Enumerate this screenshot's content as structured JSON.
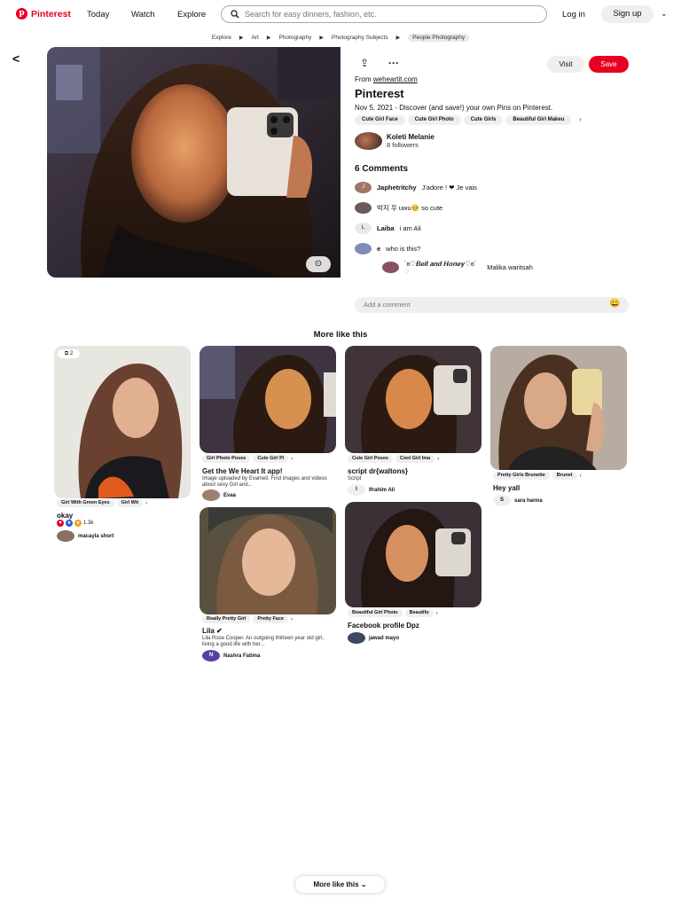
{
  "header": {
    "logo": "Pinterest",
    "nav": [
      "Today",
      "Watch",
      "Explore"
    ],
    "search_placeholder": "Search for easy dinners, fashion, etc.",
    "login": "Log in",
    "signup": "Sign up"
  },
  "breadcrumbs": [
    "Explore",
    "Art",
    "Photography",
    "Photography Subjects",
    "People Photography"
  ],
  "pin": {
    "visit": "Visit",
    "save": "Save",
    "from_label": "From",
    "from_site": "weheartit.com",
    "title": "Pinterest",
    "description": "Nov 5, 2021 - Discover (and save!) your own Pins on Pinterest.",
    "tags": [
      "Cute Girl Face",
      "Cute Girl Photo",
      "Cute Girls",
      "Beautiful Girl Makeu"
    ],
    "author": {
      "name": "Koleti Melanie",
      "followers": "8 followers"
    }
  },
  "comments": {
    "title": "6 Comments",
    "items": [
      {
        "initial": "J",
        "user": "Japhetritchy",
        "text": "J'adore ! ❤ Je vais",
        "avatar_color": "#a0766a"
      },
      {
        "initial": "",
        "user": "",
        "text": "박지 우 uwu🥺 so cute",
        "avatar_color": "#6c5a58"
      },
      {
        "initial": "L",
        "user": "Laiba",
        "text": "i am Ali",
        "avatar_color": "#e8e8e8"
      },
      {
        "initial": "",
        "user": "e",
        "text": "who is this?",
        "avatar_color": "#7f8db8"
      }
    ],
    "reply": {
      "text": "`ʚ♡𝑩𝒆𝒍𝒍 𝒂𝒏𝒅 𝑯𝒐𝒏𝒆𝒚♡ɞ´",
      "user": "Malika waritsah",
      "heart": "♡"
    },
    "add_placeholder": "Add a comment",
    "emoji": "😀"
  },
  "more_like_this": "More like this",
  "pins": [
    {
      "tags": [
        "Girl With Green Eyes",
        "Girl Wit"
      ],
      "title": "okay",
      "reactions": "1.3k",
      "user": "macayla short",
      "badge": "2"
    },
    {
      "tags": [
        "Girl Photo Poses",
        "Cute Girl Pi"
      ],
      "title": "Get the We Heart It app!",
      "desc": "Image uploaded by Evamell. Find images and videos about sexy Girl and...",
      "user": "Evaa"
    },
    {
      "tags": [
        "Cute Girl Poses",
        "Cool Girl Ima"
      ],
      "title": "script dr{waltons}",
      "desc": "Script",
      "user": "Ifrahim Ali",
      "initial": "I"
    },
    {
      "tags": [
        "Pretty Girls Brunette",
        "Brunet"
      ],
      "title": "Hey yall",
      "user": "sara hanna",
      "initial": "S"
    },
    {
      "tags": [
        "Really Pretty Girl",
        "Pretty Face"
      ],
      "title": "Lila ✔",
      "desc": "Lila Rose Cooper. An outgoing thirteen year old girl, living a good life with her...",
      "user": "Nashra Fatima",
      "initial": "N"
    },
    {
      "tags": [
        "Beautiful Girl Photo",
        "Beautifu"
      ],
      "title": "Facebook profile Dpz",
      "user": "jawad mayo"
    }
  ],
  "footer_button": "More like this",
  "colors": {
    "brand": "#e60023"
  }
}
